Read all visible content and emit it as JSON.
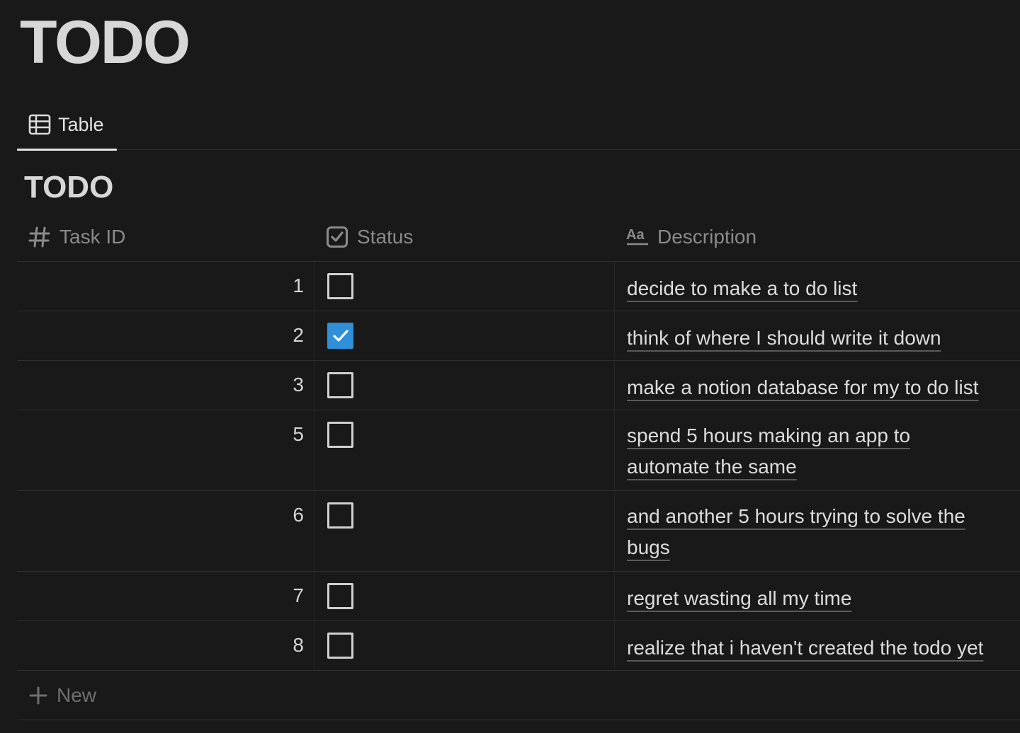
{
  "page": {
    "title": "TODO"
  },
  "views": [
    {
      "label": "Table",
      "icon": "table-icon",
      "active": true
    }
  ],
  "database": {
    "title": "TODO",
    "columns": [
      {
        "label": "Task ID",
        "icon": "number-icon"
      },
      {
        "label": "Status",
        "icon": "checkbox-property-icon"
      },
      {
        "label": "Description",
        "icon": "text-property-icon"
      }
    ],
    "rows": [
      {
        "id": "1",
        "checked": false,
        "description": "decide to make a to do list"
      },
      {
        "id": "2",
        "checked": true,
        "description": "think of where I should write it down"
      },
      {
        "id": "3",
        "checked": false,
        "description": "make a notion database for my to do list"
      },
      {
        "id": "5",
        "checked": false,
        "description_lines": [
          "spend 5 hours making an app to",
          "automate the same"
        ]
      },
      {
        "id": "6",
        "checked": false,
        "description_lines": [
          "and another 5 hours trying to solve the",
          "bugs"
        ]
      },
      {
        "id": "7",
        "checked": false,
        "description": "regret wasting all my time"
      },
      {
        "id": "8",
        "checked": false,
        "description": "realize that i haven't created the todo yet"
      }
    ],
    "new_label": "New"
  },
  "colors": {
    "background": "#191919",
    "accent": "#2f8fd8",
    "border": "#2f2f2f"
  }
}
